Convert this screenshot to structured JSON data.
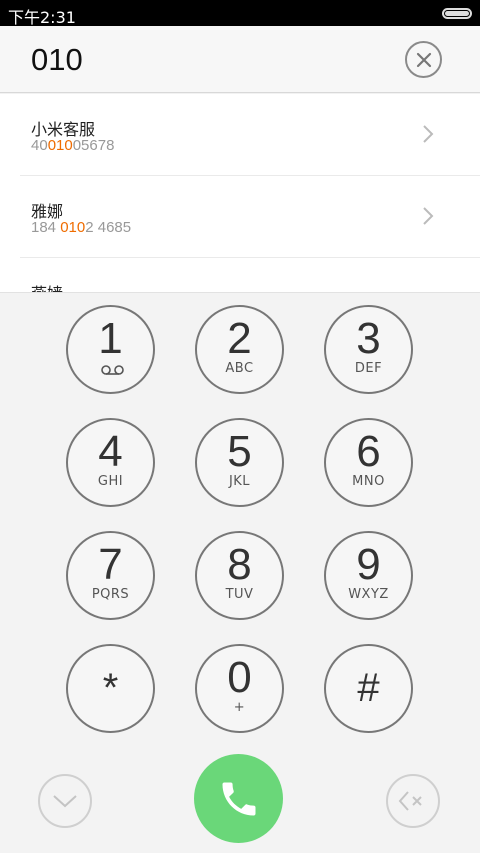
{
  "status_bar": {
    "time": "下午2:31",
    "battery_level": 1.0
  },
  "input": {
    "value": "010"
  },
  "results": [
    {
      "name": "小米客服",
      "number_parts": [
        "40",
        "010",
        "05678"
      ]
    },
    {
      "name": "雅娜",
      "number_parts": [
        "184 ",
        "010",
        "2 4685"
      ]
    },
    {
      "name": "燕嫱",
      "number_parts": [
        "",
        "",
        ""
      ]
    }
  ],
  "keys": [
    {
      "digit": "1",
      "letters": "",
      "icon": "voicemail-icon"
    },
    {
      "digit": "2",
      "letters": "ABC"
    },
    {
      "digit": "3",
      "letters": "DEF"
    },
    {
      "digit": "4",
      "letters": "GHI"
    },
    {
      "digit": "5",
      "letters": "JKL"
    },
    {
      "digit": "6",
      "letters": "MNO"
    },
    {
      "digit": "7",
      "letters": "PQRS"
    },
    {
      "digit": "8",
      "letters": "TUV"
    },
    {
      "digit": "9",
      "letters": "WXYZ"
    },
    {
      "digit": "*",
      "letters": ""
    },
    {
      "digit": "0",
      "letters": "+"
    },
    {
      "digit": "#",
      "letters": ""
    }
  ],
  "icons": {
    "clear": "close-circle-icon",
    "chevron": "chevron-right-icon",
    "collapse": "chevron-down-icon",
    "call": "phone-icon",
    "backspace": "backspace-icon"
  },
  "colors": {
    "highlight": "#ef6c00",
    "call_green": "#6ad779"
  }
}
